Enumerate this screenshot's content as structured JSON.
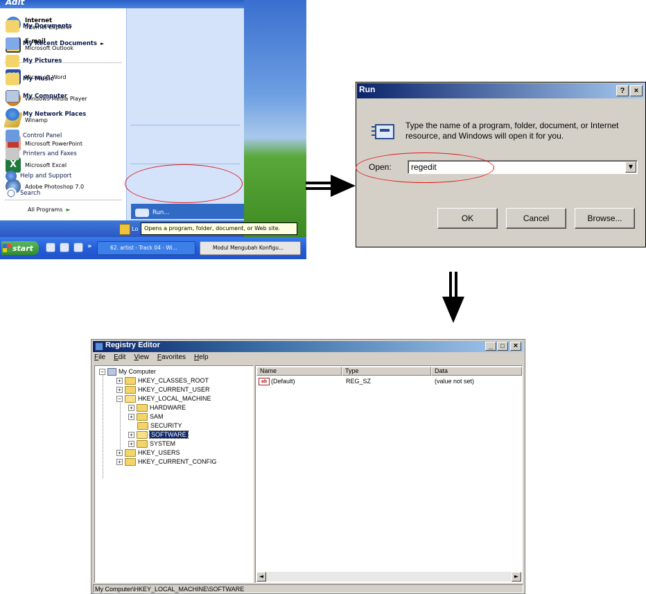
{
  "start_menu": {
    "header": "Adit",
    "pinned": [
      {
        "title": "Internet",
        "subtitle": "Internet Explorer",
        "icon": "internet-explorer-icon",
        "color": "#2f6fd6"
      },
      {
        "title": "E-mail",
        "subtitle": "Microsoft Outlook",
        "icon": "outlook-icon",
        "color": "#e8c13a"
      }
    ],
    "recent": [
      {
        "label": "Microsoft Word",
        "icon": "word-icon",
        "color": "#2b4fa8"
      },
      {
        "label": "Windows Media Player",
        "icon": "media-player-icon",
        "color": "#e67e22"
      },
      {
        "label": "Winamp",
        "icon": "winamp-icon",
        "color": "#d8b23a"
      },
      {
        "label": "Microsoft PowerPoint",
        "icon": "powerpoint-icon",
        "color": "#c0392b"
      },
      {
        "label": "Microsoft Excel",
        "icon": "excel-icon",
        "color": "#1e7a3a"
      },
      {
        "label": "Adobe Photoshop 7.0",
        "icon": "photoshop-icon",
        "color": "#2c4a7a"
      }
    ],
    "all_programs": "All Programs",
    "places": [
      {
        "label": "My Documents",
        "bold": true
      },
      {
        "label": "My Recent Documents",
        "bold": true
      },
      {
        "label": "My Pictures",
        "bold": true
      },
      {
        "label": "My Music",
        "bold": true
      },
      {
        "label": "My Computer",
        "bold": true
      },
      {
        "label": "My Network Places",
        "bold": true
      },
      {
        "label": "Control Panel",
        "bold": false
      },
      {
        "label": "Printers and Faxes",
        "bold": false
      },
      {
        "label": "Help and Support",
        "bold": false
      },
      {
        "label": "Search",
        "bold": false
      },
      {
        "label": "Run...",
        "bold": false
      }
    ],
    "logoff": "Lo",
    "tooltip": "Opens a program, folder, document, or Web site."
  },
  "taskbar": {
    "start": "start",
    "chevron": "»",
    "tasks": [
      "62. artist - Track 04 - Wi...",
      "Modul Mengubah Konfigu..."
    ]
  },
  "run_dialog": {
    "title": "Run",
    "help_btn": "?",
    "close_btn": "×",
    "description": "Type the name of a program, folder, document, or Internet resource, and Windows will open it for you.",
    "open_label": "Open:",
    "open_value": "regedit",
    "ok": "OK",
    "cancel": "Cancel",
    "browse": "Browse..."
  },
  "regedit": {
    "title": "Registry Editor",
    "min_btn": "_",
    "max_btn": "□",
    "close_btn": "×",
    "menu": [
      "File",
      "Edit",
      "View",
      "Favorites",
      "Help"
    ],
    "tree": [
      {
        "label": "My Computer",
        "level": 0,
        "expander": "−"
      },
      {
        "label": "HKEY_CLASSES_ROOT",
        "level": 1,
        "expander": "+"
      },
      {
        "label": "HKEY_CURRENT_USER",
        "level": 1,
        "expander": "+"
      },
      {
        "label": "HKEY_LOCAL_MACHINE",
        "level": 1,
        "expander": "−"
      },
      {
        "label": "HARDWARE",
        "level": 2,
        "expander": "+"
      },
      {
        "label": "SAM",
        "level": 2,
        "expander": "+"
      },
      {
        "label": "SECURITY",
        "level": 2,
        "expander": ""
      },
      {
        "label": "SOFTWARE",
        "level": 2,
        "expander": "+",
        "selected": true
      },
      {
        "label": "SYSTEM",
        "level": 2,
        "expander": "+"
      },
      {
        "label": "HKEY_USERS",
        "level": 1,
        "expander": "+"
      },
      {
        "label": "HKEY_CURRENT_CONFIG",
        "level": 1,
        "expander": "+"
      }
    ],
    "columns": [
      "Name",
      "Type",
      "Data"
    ],
    "values": [
      {
        "name": "(Default)",
        "type": "REG_SZ",
        "data": "(value not set)",
        "icon_text": "ab"
      }
    ],
    "scroll_left": "◄",
    "scroll_right": "►",
    "status": "My Computer\\HKEY_LOCAL_MACHINE\\SOFTWARE"
  }
}
